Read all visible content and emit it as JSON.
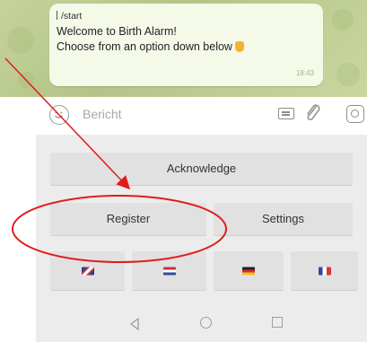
{
  "chat": {
    "command": "/start",
    "message_line1": "Welcome to Birth Alarm!",
    "message_line2": "Choose from an option down below",
    "time": "18:43"
  },
  "input": {
    "placeholder": "Bericht"
  },
  "keyboard": {
    "row1": [
      "Acknowledge"
    ],
    "row2": [
      "Register",
      "Settings"
    ],
    "flags": [
      "uk-flag-icon",
      "nl-flag-icon",
      "de-flag-icon",
      "fr-flag-icon"
    ]
  },
  "colors": {
    "annotation": "#e01c1c",
    "chat_background": "#b8c78a",
    "keyboard_background": "#ececec"
  }
}
